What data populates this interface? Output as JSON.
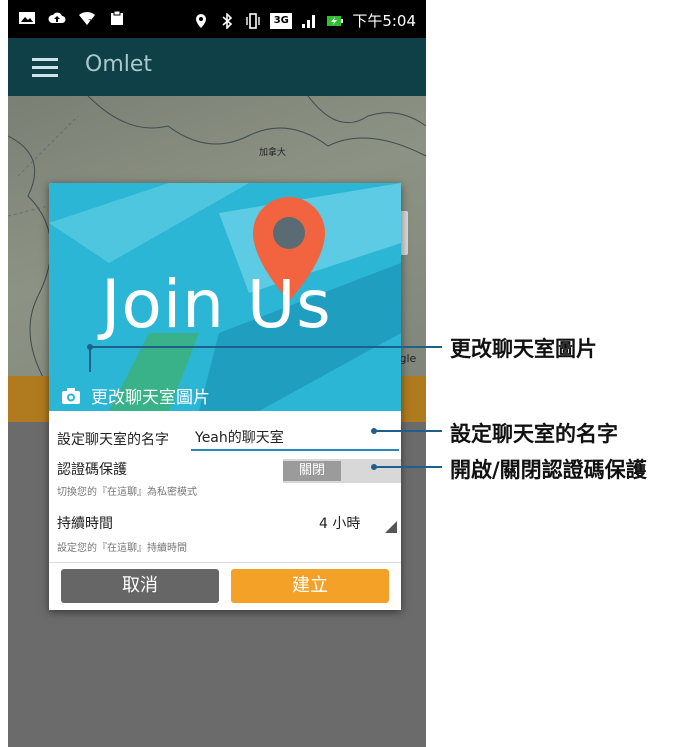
{
  "status_bar": {
    "time": "下午5:04",
    "network": "3G"
  },
  "app_bar": {
    "title": "Omlet"
  },
  "map": {
    "country_label": "加拿大",
    "attribution": "oogle"
  },
  "dialog": {
    "banner_text": "Join Us",
    "change_photo_label": "更改聊天室圖片",
    "name_label": "設定聊天室的名字",
    "name_value": "Yeah的聊天室",
    "pin_label": "認證碼保護",
    "pin_toggle_state": "關閉",
    "pin_sub": "切換您的『在這聊』為私密模式",
    "duration_label": "持續時間",
    "duration_value": "4 小時",
    "duration_sub": "設定您的『在這聊』持續時間",
    "cancel_label": "取消",
    "create_label": "建立"
  },
  "callouts": {
    "photo": "更改聊天室圖片",
    "name": "設定聊天室的名字",
    "pin": "開啟/關閉認證碼保護"
  },
  "colors": {
    "app_bar": "#0f3f47",
    "banner": "#2bb6d6",
    "accent": "#f4a127",
    "cancel": "#666666",
    "callout": "#1f5f8b",
    "underline": "#2a86b6"
  },
  "icons": {
    "status_left": [
      "image-icon",
      "cloud-upload-icon",
      "wifi-icon",
      "clipboard-icon"
    ],
    "status_right": [
      "location-icon",
      "bluetooth-icon",
      "vibrate-icon",
      "3g-icon",
      "signal-icon",
      "battery-charging-icon"
    ],
    "app_bar": "menu-icon",
    "map": "locate-icon",
    "dialog": "camera-icon"
  }
}
